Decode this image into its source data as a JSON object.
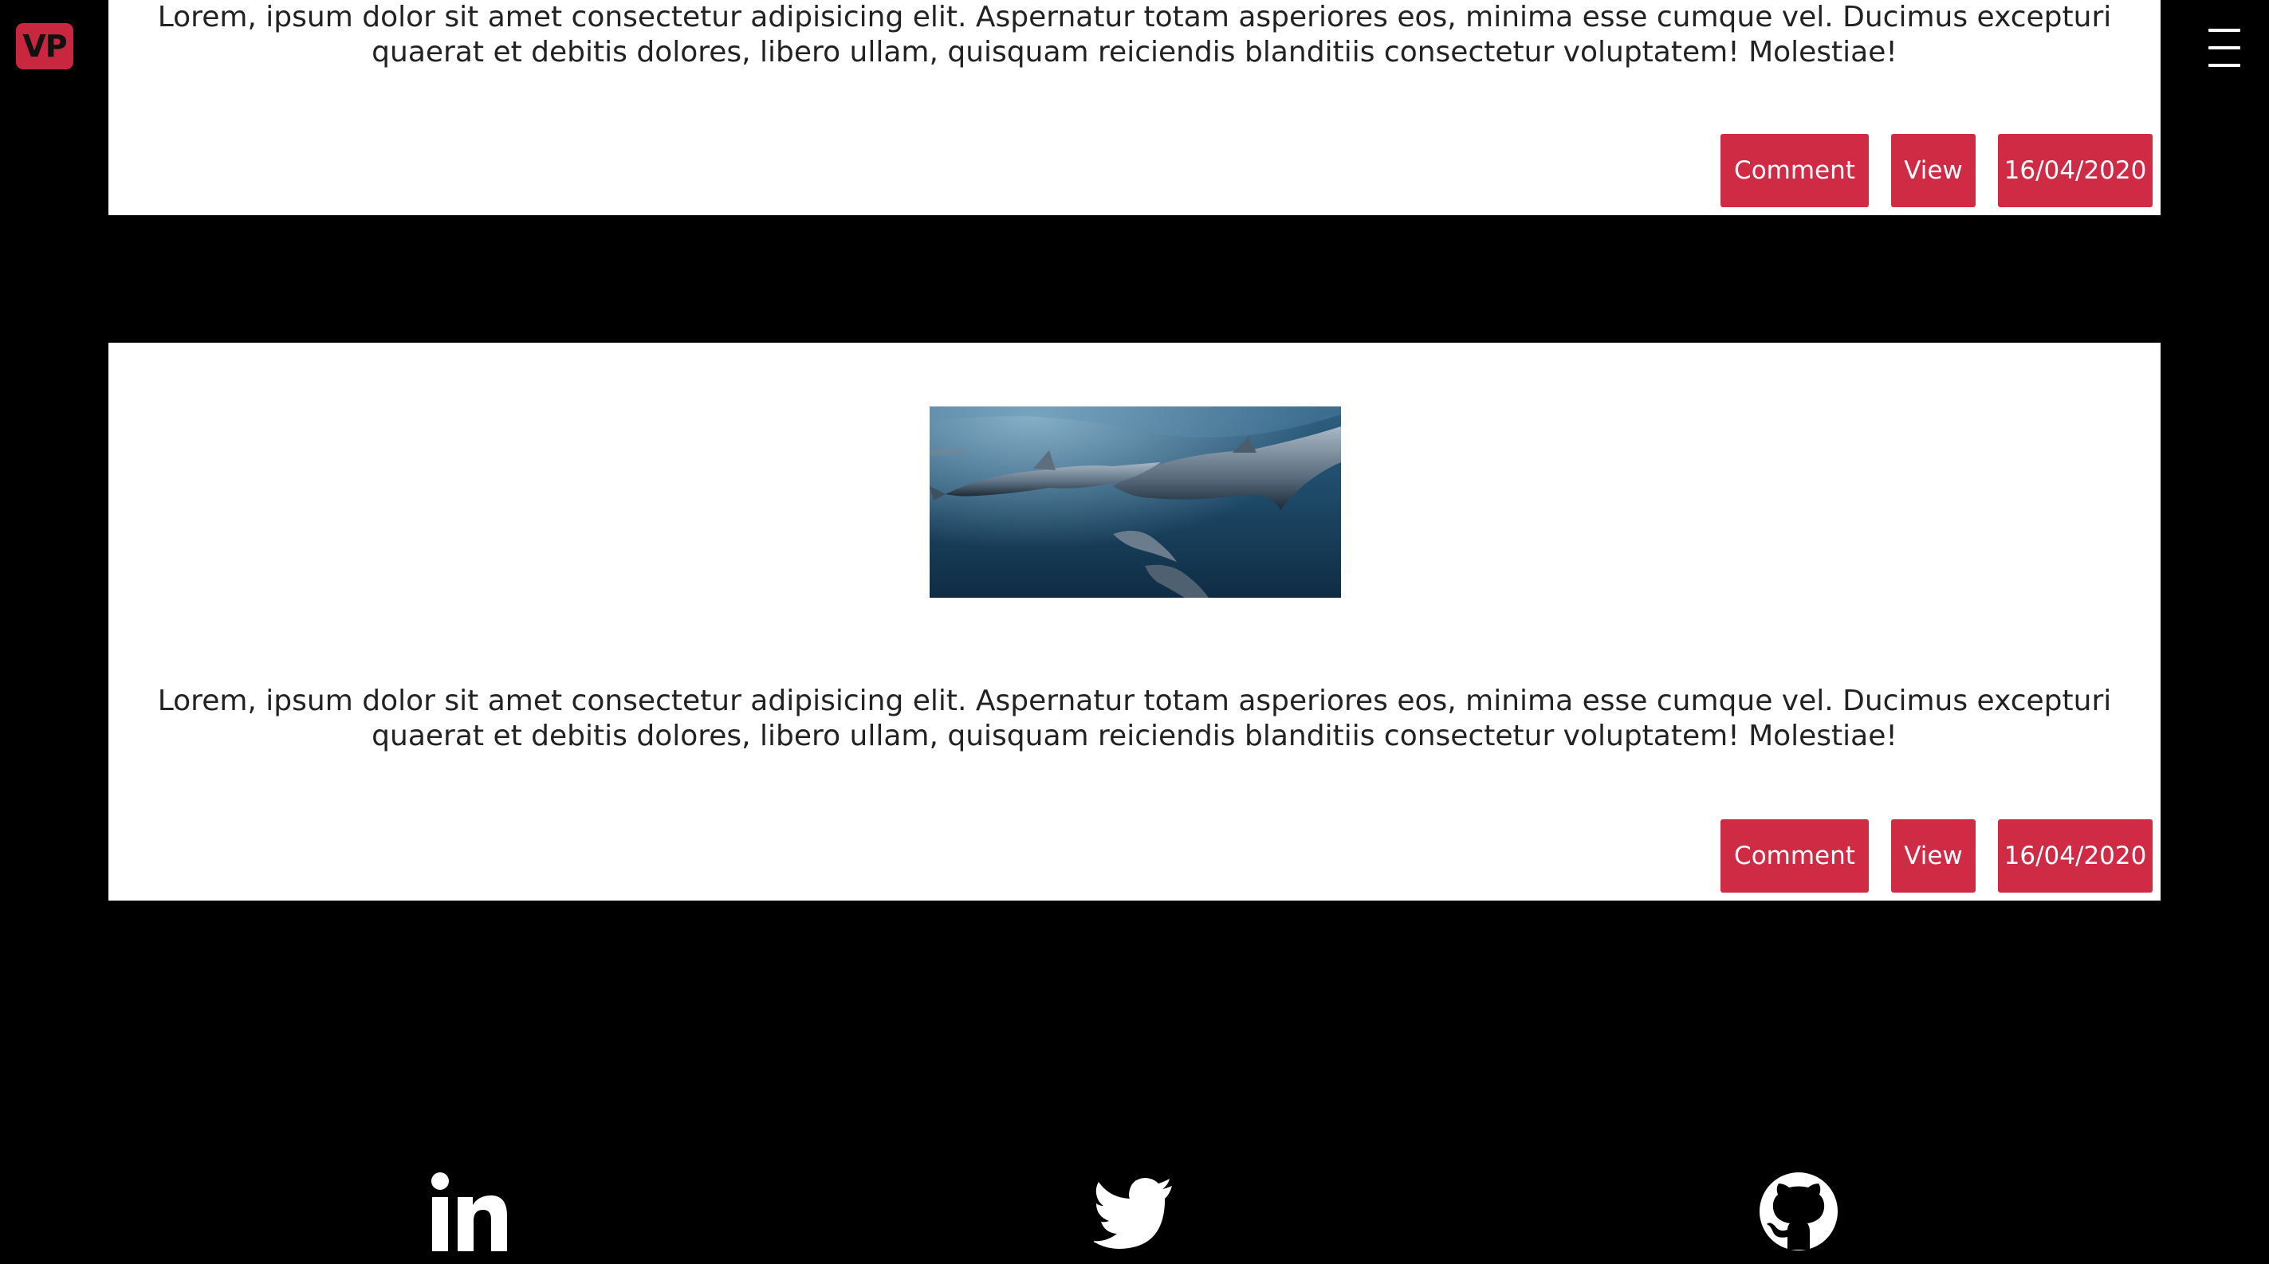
{
  "header": {
    "logo_text": "VP",
    "menu_icon": "hamburger-icon"
  },
  "posts": [
    {
      "text_line_1": "Lorem, ipsum dolor sit amet consectetur adipisicing elit. Aspernatur totam asperiores eos, minima esse cumque vel. Ducimus excepturi",
      "text_line_2": "quaerat et debitis dolores, libero ullam, quisquam reiciendis blanditiis consectetur voluptatem! Molestiae!",
      "comment_label": "Comment",
      "view_label": "View",
      "date": "16/04/2020"
    },
    {
      "image": "dolphins-underwater-photo",
      "text_line_1": "Lorem, ipsum dolor sit amet consectetur adipisicing elit. Aspernatur totam asperiores eos, minima esse cumque vel. Ducimus excepturi",
      "text_line_2": "quaerat et debitis dolores, libero ullam, quisquam reiciendis blanditiis consectetur voluptatem! Molestiae!",
      "comment_label": "Comment",
      "view_label": "View",
      "date": "16/04/2020"
    }
  ],
  "footer": {
    "icons": [
      "linkedin-icon",
      "twitter-icon",
      "github-icon"
    ]
  },
  "colors": {
    "accent": "#cf2b45",
    "logo": "#c8273f",
    "background": "#000000",
    "card": "#ffffff"
  }
}
